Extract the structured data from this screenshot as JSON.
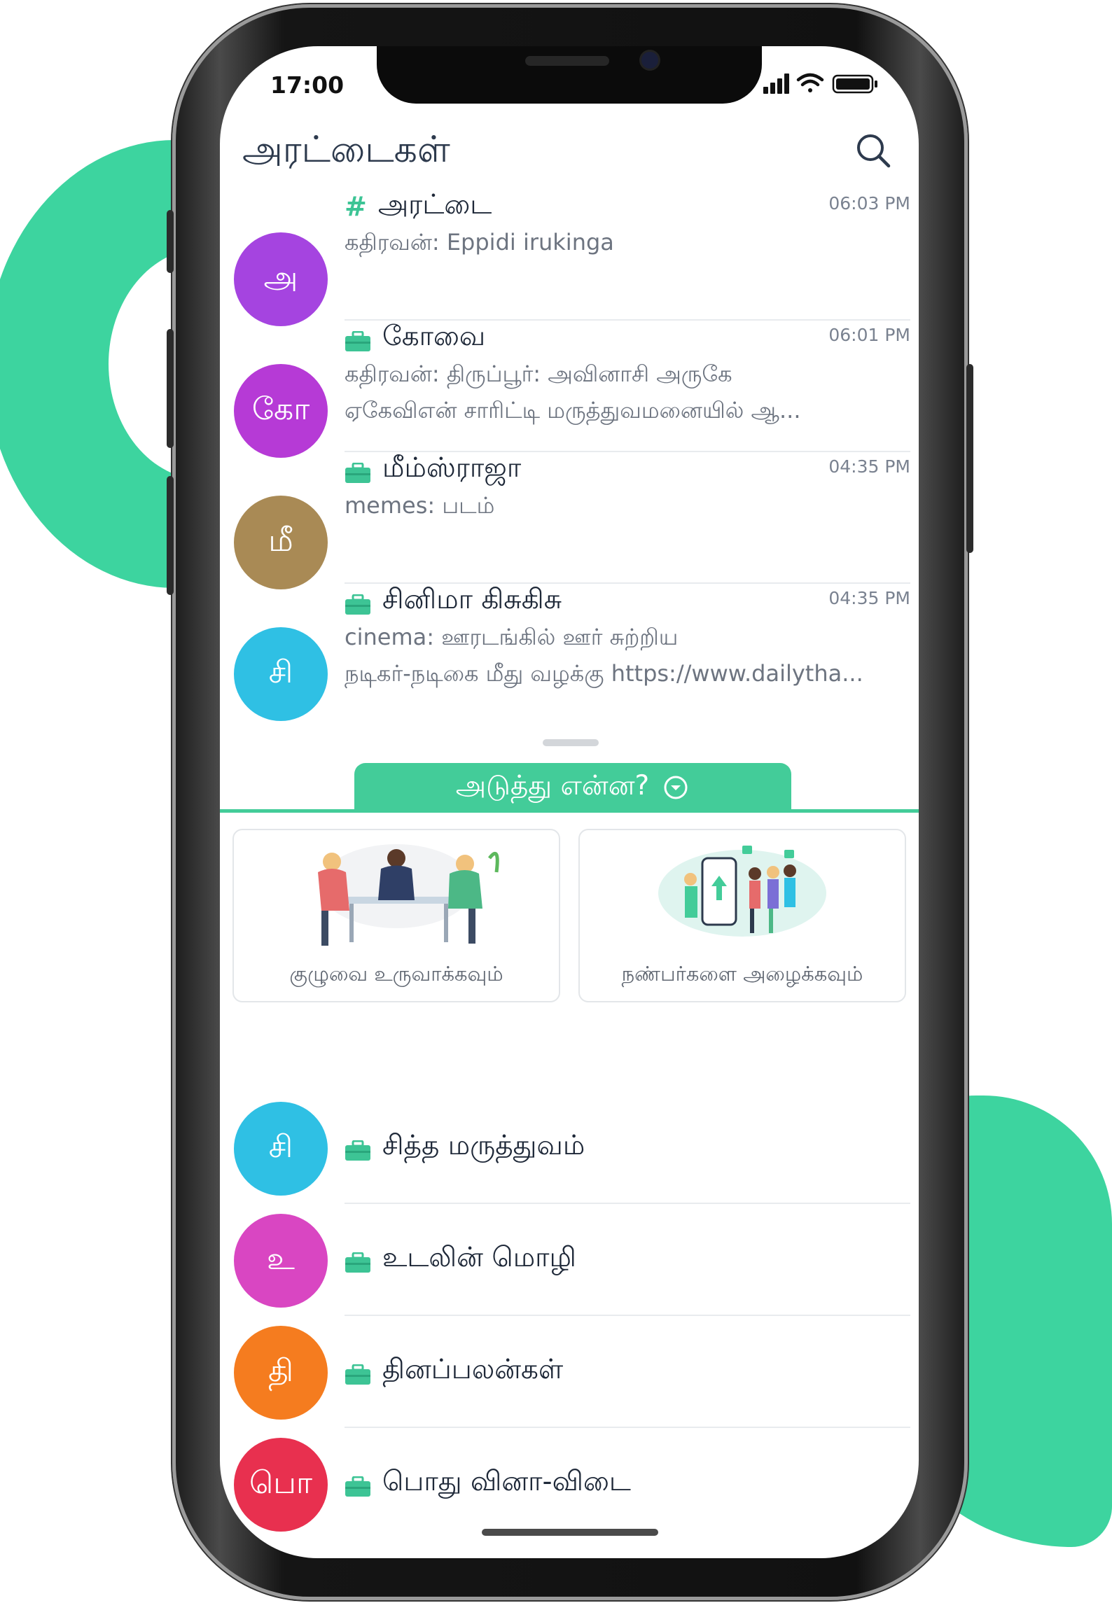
{
  "colors": {
    "accent": "#43cc99",
    "blob": "#3dd49f",
    "avatar_purple": "#a544e0",
    "avatar_magenta": "#b63ad6",
    "avatar_brown": "#a98a55",
    "avatar_cyan": "#2fc0e4",
    "avatar_pink": "#d946c2",
    "avatar_orange": "#f57c1f",
    "avatar_red": "#e8304f"
  },
  "status_bar": {
    "time": "17:00",
    "icons": [
      "signal-icon",
      "wifi-icon",
      "battery-icon"
    ]
  },
  "header": {
    "title": "அரட்டைகள்",
    "search_icon": "search-icon"
  },
  "chats": [
    {
      "avatar": "அ",
      "icon": "hash-icon",
      "title": "அரட்டை",
      "time": "06:03 PM",
      "preview": [
        "கதிரவன்: Eppidi irukinga"
      ]
    },
    {
      "avatar": "கோ",
      "icon": "briefcase-icon",
      "title": "கோவை",
      "time": "06:01 PM",
      "preview": [
        "கதிரவன்: திருப்பூர்: அவினாசி அருகே",
        "ஏகேவிஎன் சாரிட்டி மருத்துவமனையில் ஆ..."
      ]
    },
    {
      "avatar": "மீ",
      "icon": "briefcase-icon",
      "title": "மீம்ஸ்ராஜா",
      "time": "04:35 PM",
      "preview": [
        "memes: படம்"
      ]
    },
    {
      "avatar": "சி",
      "icon": "briefcase-icon",
      "title": "சினிமா கிசுகிசு",
      "time": "04:35 PM",
      "preview": [
        "cinema: ஊரடங்கில் ஊர் சுற்றிய",
        "நடிகர்-நடிகை மீது வழக்கு https://www.dailytha..."
      ]
    }
  ],
  "whats_next": {
    "label": "அடுத்து என்ன?",
    "icon": "chevron-down-circle-icon",
    "cards": [
      {
        "label": "குழுவை உருவாக்கவும்",
        "icon": "group-illustration"
      },
      {
        "label": "நண்பர்களை அழைக்கவும்",
        "icon": "invite-illustration"
      }
    ]
  },
  "suggested": [
    {
      "avatar": "சி",
      "title": "சித்த மருத்துவம்"
    },
    {
      "avatar": "உ",
      "title": "உடலின் மொழி"
    },
    {
      "avatar": "தி",
      "title": "தினப்பலன்கள்"
    },
    {
      "avatar": "பொ",
      "title": "பொது வினா-விடை"
    }
  ]
}
